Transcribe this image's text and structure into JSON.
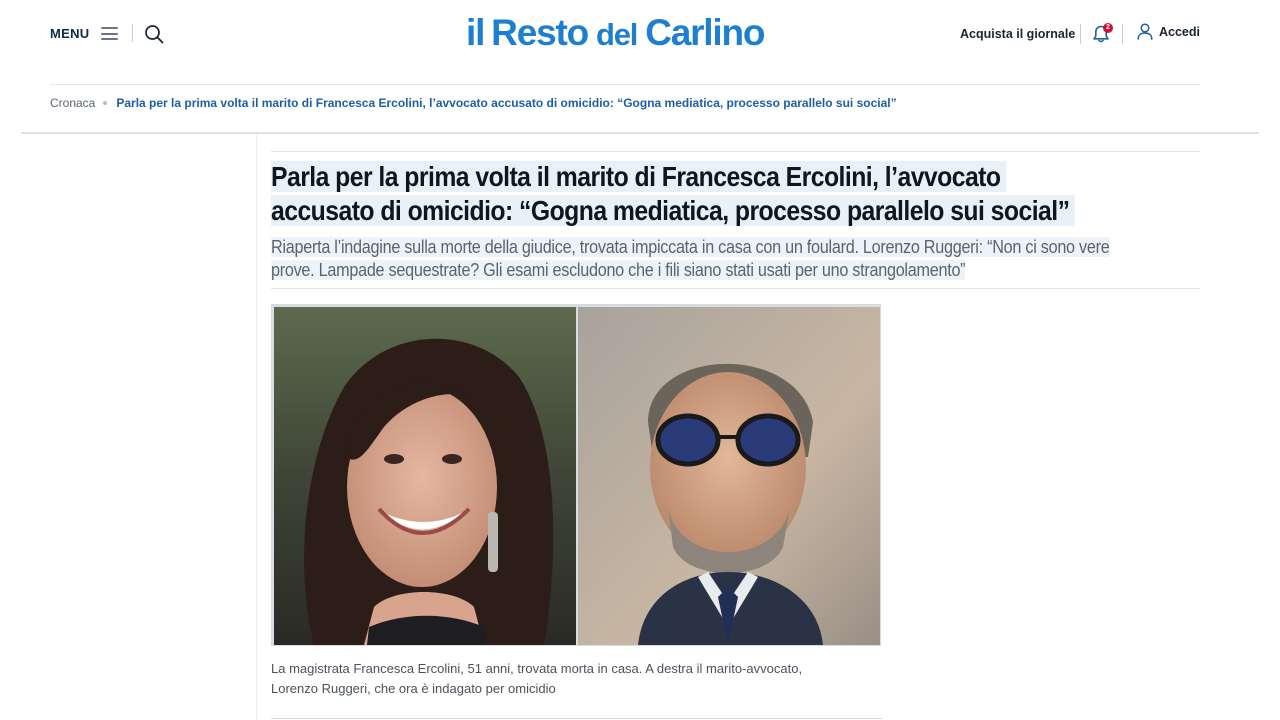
{
  "header": {
    "menu_label": "MENU",
    "logo": {
      "il": "il",
      "resto": "Resto",
      "del": "del",
      "carlino": "Carlino"
    },
    "acquista_label": "Acquista il giornale",
    "notifications_count": "2",
    "accedi_label": "Accedi"
  },
  "icons": {
    "menu": "hamburger-icon",
    "search": "search-icon",
    "notifications": "bell-icon",
    "account": "user-icon"
  },
  "breadcrumb": {
    "home": "Cronaca",
    "current": "Parla per la prima volta il marito di Francesca Ercolini, l’avvocato accusato di omicidio: “Gogna mediatica, processo parallelo sui social”"
  },
  "article": {
    "headline": "Parla per la prima volta il marito di Francesca Ercolini, l’avvocato accusato di omicidio: “Gogna mediatica, processo parallelo sui social”",
    "subtitle": "Riaperta l’indagine sulla morte della giudice, trovata impiccata in casa con un foulard. Lorenzo Ruggeri: “Non ci sono vere prove. Lampade sequestrate? Gli esami escludono che i fili siano stati usati per uno strangolamento”",
    "caption_line1": "La magistrata Francesca Ercolini, 51 anni, trovata morta in casa. A destra il marito-avvocato,",
    "caption_line2": "Lorenzo Ruggeri, che ora è indagato per omicidio"
  },
  "colors": {
    "brand": "#1d7fd1",
    "breadcrumb_link": "#1d5ea8",
    "badge": "#d0103a",
    "headline_highlight": "#e8f0f8"
  }
}
